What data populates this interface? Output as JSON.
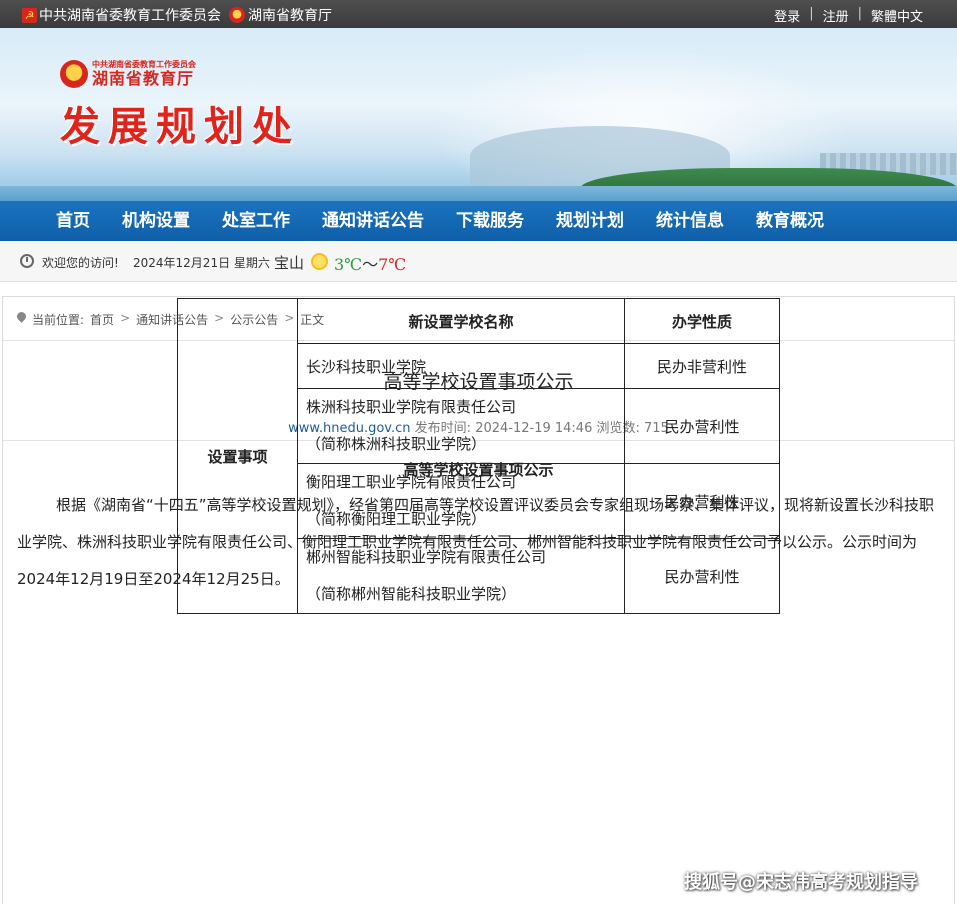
{
  "topbar": {
    "party_org": "中共湖南省委教育工作委员会",
    "gov_org": "湖南省教育厅",
    "login": "登录",
    "register": "注册",
    "lang": "繁體中文",
    "sep": "|"
  },
  "banner": {
    "org_small": "中共湖南省委教育工作委员会",
    "org_big": "湖南省教育厅",
    "dept": "发展规划处"
  },
  "nav": [
    "首页",
    "机构设置",
    "处室工作",
    "通知讲话公告",
    "下载服务",
    "规划计划",
    "统计信息",
    "教育概况"
  ],
  "welcome": {
    "text": "欢迎您的访问!",
    "date": "2024年12月21日 星期六",
    "city": "宝山",
    "temp_low": "3℃",
    "tilde": "～",
    "temp_high": "7℃"
  },
  "breadcrumb": {
    "label": "当前位置:",
    "items": [
      "首页",
      "通知讲话公告",
      "公示公告",
      "正文"
    ],
    "arrow": ">"
  },
  "article": {
    "title": "高等学校设置事项公示",
    "site": "www.hnedu.gov.cn",
    "publish_label": "发布时间:",
    "publish_time": "2024-12-19 14:46",
    "views_label": "浏览数:",
    "views": "715",
    "body_title": "高等学校设置事项公示",
    "paragraph": "根据《湖南省“十四五”高等学校设置规划》，经省第四届高等学校设置评议委员会专家组现场考察、集体评议，现将新设置长沙科技职业学院、株洲科技职业学院有限责任公司、衡阳理工职业学院有限责任公司、郴州智能科技职业学院有限责任公司予以公示。公示时间为2024年12月19日至2024年12月25日。"
  },
  "table": {
    "header_name": "新设置学校名称",
    "header_nature": "办学性质",
    "row_label": "设置事项",
    "rows": [
      {
        "name": "长沙科技职业学院",
        "short": "",
        "nature": "民办非营利性"
      },
      {
        "name": "株洲科技职业学院有限责任公司",
        "short": "（简称株洲科技职业学院）",
        "nature": "民办营利性"
      },
      {
        "name": "衡阳理工职业学院有限责任公司",
        "short": "（简称衡阳理工职业学院）",
        "nature": "民办营利性"
      },
      {
        "name": "郴州智能科技职业学院有限责任公司",
        "short": "（简称郴州智能科技职业学院）",
        "nature": "民办营利性"
      }
    ]
  },
  "watermark": "搜狐号@宋志伟高考规划指导",
  "colors": {
    "nav_bg": "#1b73bf",
    "dept_red": "#e0241b",
    "link_blue": "#1c5c9e"
  }
}
